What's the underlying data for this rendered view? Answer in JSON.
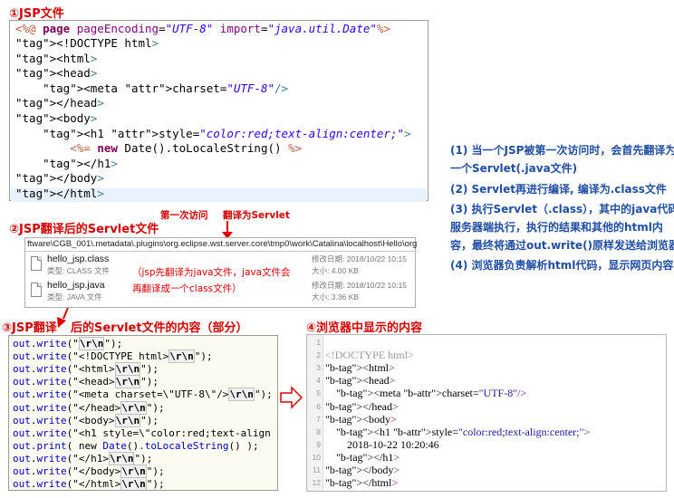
{
  "section1": {
    "title": "①JSP文件",
    "lines": [
      [
        "<%@",
        " page ",
        "pageEncoding",
        "=",
        "\"UTF-8\"",
        " ",
        "import",
        "=",
        "\"java.util.Date\"",
        "%>"
      ],
      "<!DOCTYPE html>",
      "<html>",
      "<head>",
      "    <meta charset=\"UTF-8\"/>",
      "</head>",
      "<body>",
      "    <h1 style=\"color:red;text-align:center;\">",
      "        <%= new Date().toLocaleString() %>",
      "    </h1>",
      "</body>",
      "</html>"
    ]
  },
  "section2": {
    "title": "②JSP翻译后的Servlet文件",
    "annotation_left": "第一次访问",
    "annotation_right": "翻译为Servlet",
    "path": "ftware\\CGB_001\\.metadata\\.plugins\\org.eclipse.wst.server.core\\tmp0\\work\\Catalina\\localhost\\Hello\\org\\apache\\jsp",
    "files": [
      {
        "name": "hello_jsp.class",
        "type": "类型: CLASS 文件",
        "date": "修改日期: 2018/10/22 10:15",
        "size": "大小: 4.00 KB"
      },
      {
        "name": "hello_jsp.java",
        "type": "类型: JAVA 文件",
        "date": "修改日期: 2018/10/22 10:15",
        "size": "大小: 3.36 KB"
      }
    ],
    "note_line1": "（jsp先翻译为java文件，java文件会",
    "note_line2": "再翻译成一个class文件）"
  },
  "section3": {
    "title_a": "③JSP翻译",
    "title_b": "后的Servlet文件的内容（部分）",
    "lines": [
      "out.write(\"\\r\\n\");",
      "out.write(\"<!DOCTYPE html>\\r\\n\");",
      "out.write(\"<html>\\r\\n\");",
      "out.write(\"<head>\\r\\n\");",
      "out.write(\"<meta charset=\\\"UTF-8\\\"/>\\r\\n\");",
      "out.write(\"</head>\\r\\n\");",
      "out.write(\"<body>\\r\\n\");",
      "out.write(\"<h1 style=\\\"color:red;text-align",
      "out.print( new Date().toLocaleString() );",
      "out.write(\"</h1>\\r\\n\");",
      "out.write(\"</body>\\r\\n\");",
      "out.write(\"</html>\\r\\n\");"
    ]
  },
  "section4": {
    "title": "④浏览器中显示的内容",
    "line_numbers": [
      "1",
      "2",
      "3",
      "4",
      "5",
      "6",
      "7",
      "8",
      "9",
      "10",
      "11",
      "12"
    ],
    "lines": [
      "",
      "<!DOCTYPE html>",
      "<html>",
      "<head>",
      "    <meta charset=\"UTF-8\"/>",
      "</head>",
      "<body>",
      "    <h1 style=\"color:red;text-align:center;\">",
      "        2018-10-22 10:20:46",
      "    </h1>",
      "</body>",
      "</html>"
    ]
  },
  "notes": [
    "(1) 当一个JSP被第一次访问时，会首先翻译为",
    "一个Servlet(.java文件)",
    "(2) Servlet再进行编译, 编译为.class文件",
    "(3) 执行Servlet（.class），其中的java代码在",
    "服务器端执行，执行的结果和其他的html内",
    "容，最终将通过out.write()原样发送给浏览器",
    "(4) 浏览器负责解析html代码，显示网页内容"
  ],
  "colors": {
    "title_red": "#d40000",
    "note_blue": "#1f4ea3",
    "arrow_red": "#e00000"
  }
}
